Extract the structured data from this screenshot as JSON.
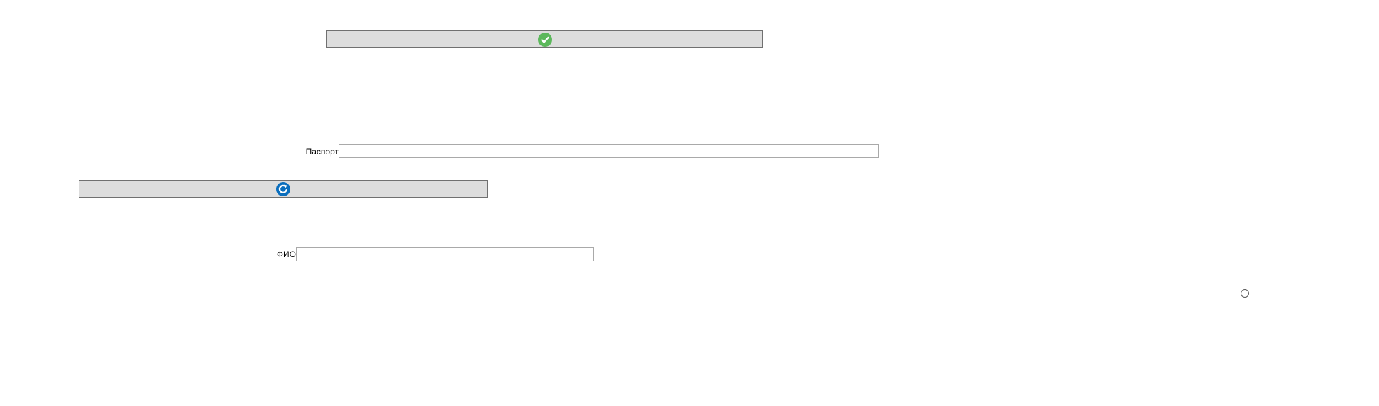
{
  "confirm_button": {
    "icon": "check-circle-icon",
    "color": "#5cb85c"
  },
  "passport": {
    "label": "Паспорт",
    "value": "",
    "placeholder": ""
  },
  "refresh_button": {
    "icon": "refresh-icon",
    "color": "#0a6ebd"
  },
  "fio": {
    "label": "ФИО",
    "value": "",
    "placeholder": ""
  },
  "radio_option": {
    "checked": false
  }
}
